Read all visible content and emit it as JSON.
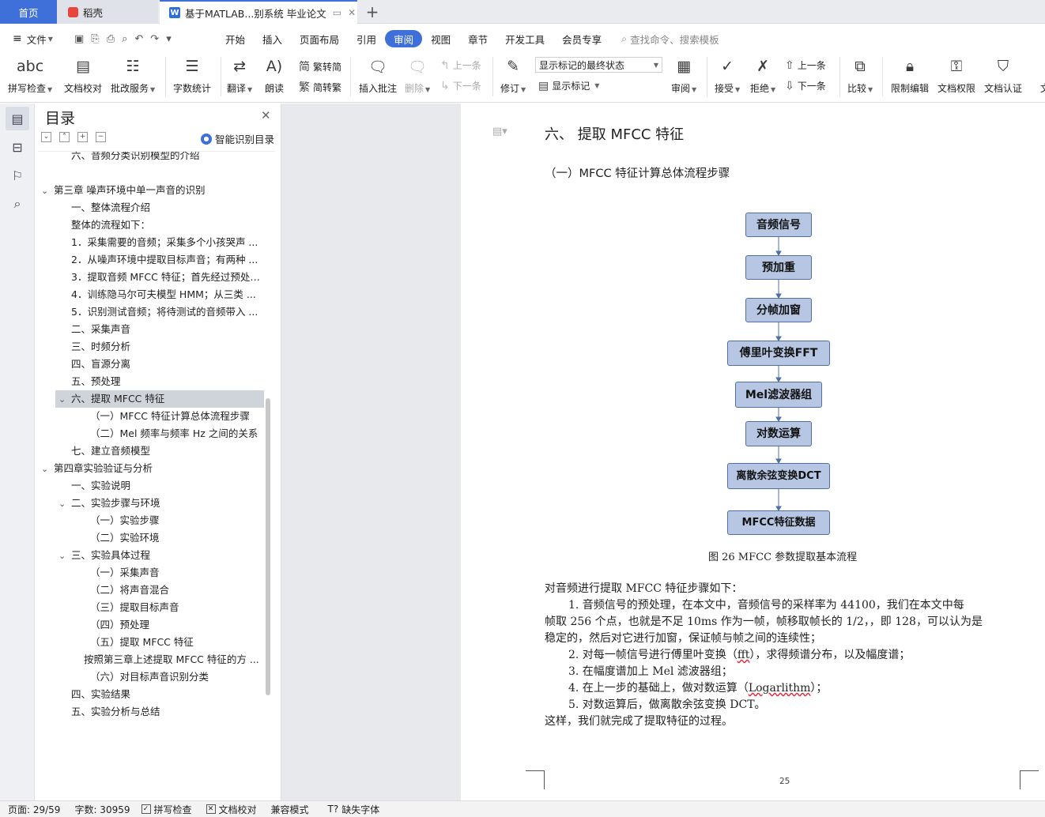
{
  "tabs": {
    "home": "首页",
    "daoke": "稻壳",
    "doc": "基于MATLAB...别系统 毕业论文"
  },
  "menu": {
    "file": "文件",
    "items": [
      "开始",
      "插入",
      "页面布局",
      "引用",
      "审阅",
      "视图",
      "章节",
      "开发工具",
      "会员专享"
    ],
    "search_placeholder": "查找命令、搜索模板"
  },
  "ribbon": {
    "spell_check": "拼写检查",
    "doc_proof": "文档校对",
    "batch_service": "批改服务",
    "word_count": "字数统计",
    "translate": "翻译",
    "read_aloud": "朗读",
    "trad_to_simp": "繁转简",
    "simp_to_trad": "简转繁",
    "insert_comment": "插入批注",
    "delete": "删除",
    "prev_comment": "上一条",
    "next_comment": "下一条",
    "revise": "修订",
    "markup_state": "显示标记的最终状态",
    "show_markup": "显示标记",
    "review": "审阅",
    "accept": "接受",
    "reject": "拒绝",
    "prev_change": "上一条",
    "next_change": "下一条",
    "compare": "比较",
    "restrict_edit": "限制编辑",
    "doc_permission": "文档权限",
    "doc_cert": "文档认证",
    "cut_label": "文"
  },
  "toc": {
    "title": "目录",
    "smart": "智能识别目录",
    "items": [
      {
        "text": "六、音频分类识别模型的介绍",
        "level": 1,
        "chev": ""
      },
      {
        "text": "第三章 噪声环境中单一声音的识别",
        "level": 0,
        "chev": "v"
      },
      {
        "text": "一、整体流程介绍",
        "level": 1,
        "chev": ""
      },
      {
        "text": "整体的流程如下：",
        "level": 1,
        "chev": ""
      },
      {
        "text": "1．采集需要的音频；采集多个小孩哭声 ...",
        "level": 1,
        "chev": ""
      },
      {
        "text": "2．从噪声环境中提取目标声音；有两种 ...",
        "level": 1,
        "chev": ""
      },
      {
        "text": "3．提取音频 MFCC 特征；首先经过预处 ...",
        "level": 1,
        "chev": ""
      },
      {
        "text": "4．训练隐马尔可夫模型 HMM；从三类 ...",
        "level": 1,
        "chev": ""
      },
      {
        "text": "5．识别测试音频；将待测试的音频带入 ...",
        "level": 1,
        "chev": ""
      },
      {
        "text": "二、采集声音",
        "level": 1,
        "chev": ""
      },
      {
        "text": "三、时频分析",
        "level": 1,
        "chev": ""
      },
      {
        "text": "四、盲源分离",
        "level": 1,
        "chev": ""
      },
      {
        "text": "五、预处理",
        "level": 1,
        "chev": ""
      },
      {
        "text": "六、提取 MFCC 特征",
        "level": 1,
        "chev": "v",
        "selected": true
      },
      {
        "text": "（一）MFCC 特征计算总体流程步骤",
        "level": 2,
        "chev": ""
      },
      {
        "text": "（二）Mel 频率与频率 Hz 之间的关系",
        "level": 2,
        "chev": ""
      },
      {
        "text": "七、建立音频模型",
        "level": 1,
        "chev": ""
      },
      {
        "text": "第四章实验验证与分析",
        "level": 0,
        "chev": "v"
      },
      {
        "text": "一、实验说明",
        "level": 1,
        "chev": ""
      },
      {
        "text": "二、实验步骤与环境",
        "level": 1,
        "chev": "v"
      },
      {
        "text": "（一）实验步骤",
        "level": 2,
        "chev": ""
      },
      {
        "text": "（二）实验环境",
        "level": 2,
        "chev": ""
      },
      {
        "text": "三、实验具体过程",
        "level": 1,
        "chev": "v"
      },
      {
        "text": "（一）采集声音",
        "level": 2,
        "chev": ""
      },
      {
        "text": "（二）将声音混合",
        "level": 2,
        "chev": ""
      },
      {
        "text": "（三）提取目标声音",
        "level": 2,
        "chev": ""
      },
      {
        "text": "（四）预处理",
        "level": 2,
        "chev": ""
      },
      {
        "text": "（五）提取 MFCC 特征",
        "level": 2,
        "chev": ""
      },
      {
        "text": "按照第三章上述提取 MFCC 特征的方 ...",
        "level": 3,
        "chev": ""
      },
      {
        "text": "（六）对目标声音识别分类",
        "level": 2,
        "chev": ""
      },
      {
        "text": "四、实验结果",
        "level": 1,
        "chev": ""
      },
      {
        "text": "五、实验分析与总结",
        "level": 1,
        "chev": ""
      }
    ]
  },
  "doc": {
    "heading": "六、 提取 MFCC 特征",
    "subheading": "（一）MFCC 特征计算总体流程步骤",
    "flow": [
      "音频信号",
      "预加重",
      "分帧加窗",
      "傅里叶变换FFT",
      "Mel滤波器组",
      "对数运算",
      "离散余弦变换DCT",
      "MFCC特征数据"
    ],
    "caption": "图 26 MFCC 参数提取基本流程",
    "intro": "对音频进行提取 MFCC 特征步骤如下：",
    "step1_a": "1. 音频信号的预处理，在本文中，音频信号的采样率为 44100，我们在本文中每",
    "step1_b": "帧取 256 个点，也就是不足 10ms 作为一帧，帧移取帧长的 1/2，，即 128，可以认为是",
    "step1_c": "稳定的，然后对它进行加窗，保证帧与帧之间的连续性；",
    "step2_pre": "2. 对每一帧信号进行傅里叶变换（",
    "step2_fft": "fft",
    "step2_post": "），求得频谱分布，以及幅度谱；",
    "step3": "3. 在幅度谱加上 Mel 滤波器组；",
    "step4_pre": "4. 在上一步的基础上，做对数运算（",
    "step4_log": "Logarlithm",
    "step4_post": "）；",
    "step5": "5. 对数运算后，做离散余弦变换 DCT。",
    "conclusion": "这样，我们就完成了提取特征的过程。",
    "page_number": "25"
  },
  "status": {
    "page": "页面: 29/59",
    "words": "字数: 30959",
    "spell": "拼写检查",
    "proof": "文档校对",
    "compat": "兼容模式",
    "missing_font": "缺失字体"
  }
}
